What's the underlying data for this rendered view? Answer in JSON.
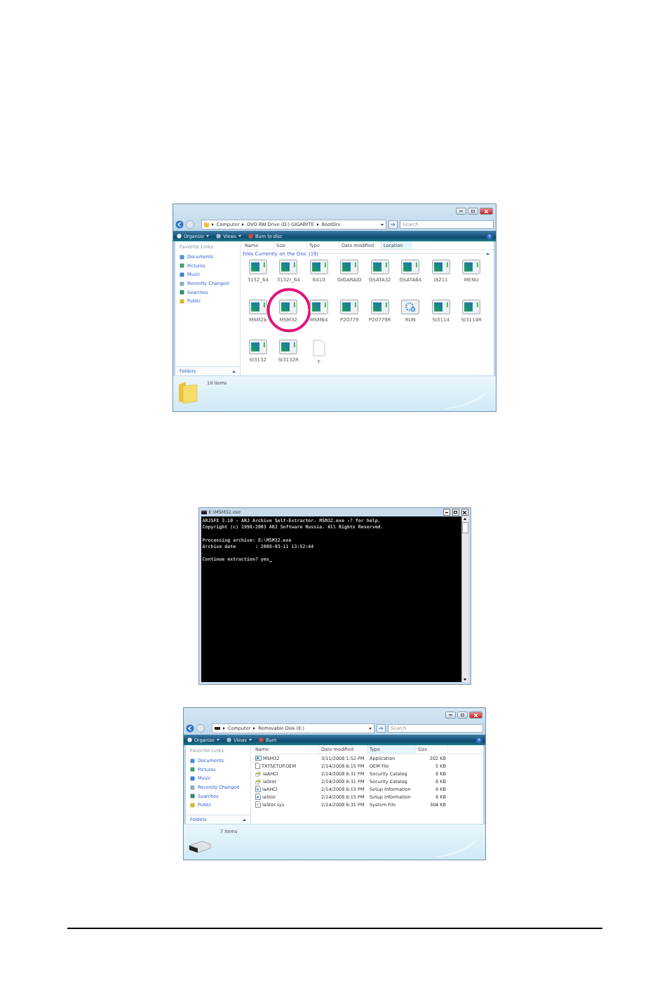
{
  "disc_window": {
    "breadcrumb": [
      "Computer",
      "DVD RW Drive (D:) GIGABYTE",
      "BootDrv"
    ],
    "search_placeholder": "Search",
    "toolbar": [
      "Organize",
      "Views",
      "Burn to disc"
    ],
    "favorite_links_title": "Favorite Links",
    "favorite_links": [
      "Documents",
      "Pictures",
      "Music",
      "Recently Changed",
      "Searches",
      "Public"
    ],
    "folders": "Folders",
    "columns": [
      {
        "label": "Name",
        "selected": false
      },
      {
        "label": "Size",
        "selected": false
      },
      {
        "label": "Type",
        "selected": false
      },
      {
        "label": "Date modified",
        "selected": false
      },
      {
        "label": "Location",
        "selected": true
      }
    ],
    "group": "Files Currently on the Disc (19)",
    "files": [
      {
        "name": "3132_64",
        "kind": "app",
        "circled": false
      },
      {
        "name": "3132r_64",
        "kind": "app",
        "circled": false
      },
      {
        "name": "6410",
        "kind": "app",
        "circled": false
      },
      {
        "name": "GIGARAID",
        "kind": "app",
        "circled": false
      },
      {
        "name": "GSATA32",
        "kind": "app",
        "circled": false
      },
      {
        "name": "GSATA64",
        "kind": "app",
        "circled": false
      },
      {
        "name": "i8211",
        "kind": "app",
        "circled": false
      },
      {
        "name": "MENU",
        "kind": "app",
        "circled": false
      },
      {
        "name": "MSM2k",
        "kind": "app",
        "circled": false
      },
      {
        "name": "MSM32",
        "kind": "app",
        "circled": true
      },
      {
        "name": "MSM64",
        "kind": "app",
        "circled": false
      },
      {
        "name": "P20779",
        "kind": "app",
        "circled": false
      },
      {
        "name": "P20779R",
        "kind": "app",
        "circled": false
      },
      {
        "name": "RUN",
        "kind": "setup",
        "circled": false
      },
      {
        "name": "SI3114",
        "kind": "app",
        "circled": false
      },
      {
        "name": "SI3114R",
        "kind": "app",
        "circled": false
      },
      {
        "name": "SI3132",
        "kind": "app",
        "circled": false
      },
      {
        "name": "SI3132R",
        "kind": "app",
        "circled": false
      },
      {
        "name": "Y",
        "kind": "blank",
        "circled": false
      }
    ],
    "status": "19 items"
  },
  "console_window": {
    "title": "E:\\MSM32.exe",
    "paragraphs": [
      [
        "ARJSFX 3.10 - ARJ Archive Self-Extractor. MSM32.exe -? for help.",
        "Copyright (c) 1998-2003 ARJ Software Russia. All Rights Reserved."
      ],
      [
        "Processing archive: E:\\MSM32.exe",
        "Archive date       : 2008-03-11 13:52:44"
      ],
      [
        "Continue extraction? yes"
      ]
    ]
  },
  "disk_window": {
    "breadcrumb": [
      "Computer",
      "Removable Disk (E:)"
    ],
    "search_placeholder": "Search",
    "toolbar": [
      "Organize",
      "Views",
      "Burn"
    ],
    "favorite_links_title": "Favorite Links",
    "favorite_links": [
      "Documents",
      "Pictures",
      "Music",
      "Recently Changed",
      "Searches",
      "Public"
    ],
    "folders": "Folders",
    "columns": [
      {
        "label": "Name",
        "selected": false
      },
      {
        "label": "Date modified",
        "selected": false
      },
      {
        "label": "Type",
        "selected": true
      },
      {
        "label": "Size",
        "selected": false
      }
    ],
    "rows": [
      {
        "name": "MSM32",
        "date": "3/11/2008 1:52 PM",
        "type": "Application",
        "size": "202 KB",
        "kind": "app"
      },
      {
        "name": "TXTSETUP.OEM",
        "date": "2/14/2008 6:15 PM",
        "type": "OEM File",
        "size": "5 KB",
        "kind": "text"
      },
      {
        "name": "iaAHCI",
        "date": "2/14/2008 6:31 PM",
        "type": "Security Catalog",
        "size": "8 KB",
        "kind": "catalog"
      },
      {
        "name": "iaStor",
        "date": "2/14/2008 6:31 PM",
        "type": "Security Catalog",
        "size": "8 KB",
        "kind": "catalog"
      },
      {
        "name": "iaAHCI",
        "date": "2/14/2008 6:15 PM",
        "type": "Setup Information",
        "size": "9 KB",
        "kind": "setup"
      },
      {
        "name": "iaStor",
        "date": "2/14/2008 6:15 PM",
        "type": "Setup Information",
        "size": "8 KB",
        "kind": "setup"
      },
      {
        "name": "IaStor.sys",
        "date": "2/14/2008 6:31 PM",
        "type": "System File",
        "size": "304 KB",
        "kind": "sys"
      }
    ],
    "status": "7 items"
  }
}
